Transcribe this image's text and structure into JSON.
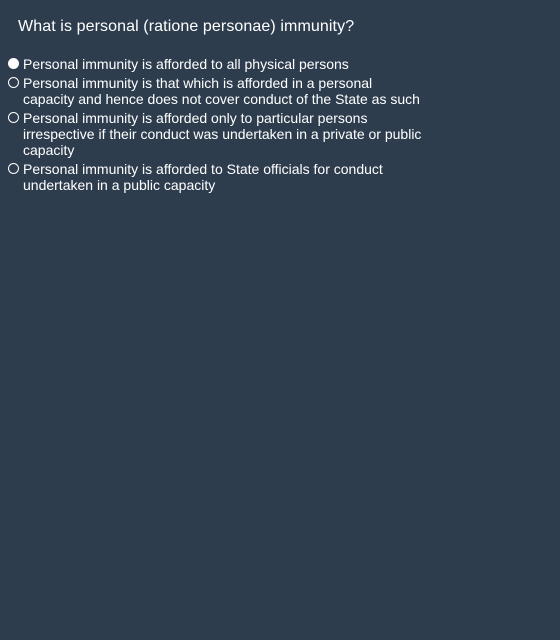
{
  "question": "What is personal (ratione personae) immunity?",
  "options": [
    {
      "label": "Personal immunity is afforded to all physical persons",
      "selected": true
    },
    {
      "label": "Personal immunity is that which is afforded in a personal capacity and hence does not cover conduct of the State as such",
      "selected": false
    },
    {
      "label": "Personal immunity is afforded only to particular persons irrespective if their conduct was undertaken in a private or public capacity",
      "selected": false
    },
    {
      "label": "Personal immunity is afforded to State officials for conduct undertaken in a public capacity",
      "selected": false
    }
  ]
}
